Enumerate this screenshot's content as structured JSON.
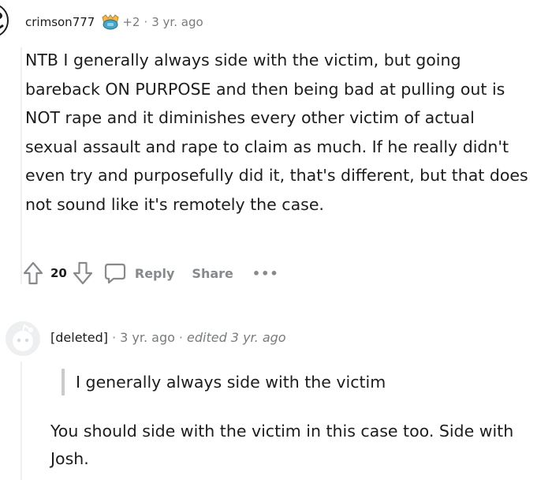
{
  "comment1": {
    "username": "crimson777",
    "award_count": "+2",
    "separator": "·",
    "time": "3 yr. ago",
    "body": "NTB I generally always side with the victim, but going bareback ON PURPOSE and then being bad at pulling out is NOT rape and it diminishes every other victim of actual sexual assault and rape to claim as much. If he really didn't even try and purposefully did it, that's different, but that does not sound like it's remotely the case.",
    "vote_count": "20",
    "reply_label": "Reply",
    "share_label": "Share",
    "more_label": "•••",
    "icons": {
      "avatar": "avatar-raccoon-icon",
      "award": "award-icon",
      "upvote": "upvote-arrow-icon",
      "downvote": "downvote-arrow-icon",
      "reply": "speech-bubble-icon"
    }
  },
  "comment2": {
    "username": "[deleted]",
    "separator": "·",
    "time": "3 yr. ago",
    "edited": "edited 3 yr. ago",
    "quote": "I generally always side with the victim",
    "body": "You should side with the victim in this case too. Side with Josh.",
    "icons": {
      "avatar": "default-avatar-icon"
    }
  },
  "colors": {
    "text": "#1c1c1c",
    "meta": "#787c7e",
    "action_gray": "#878a8c",
    "thread_line": "#edeff1",
    "quote_bar": "#c9ccce"
  }
}
